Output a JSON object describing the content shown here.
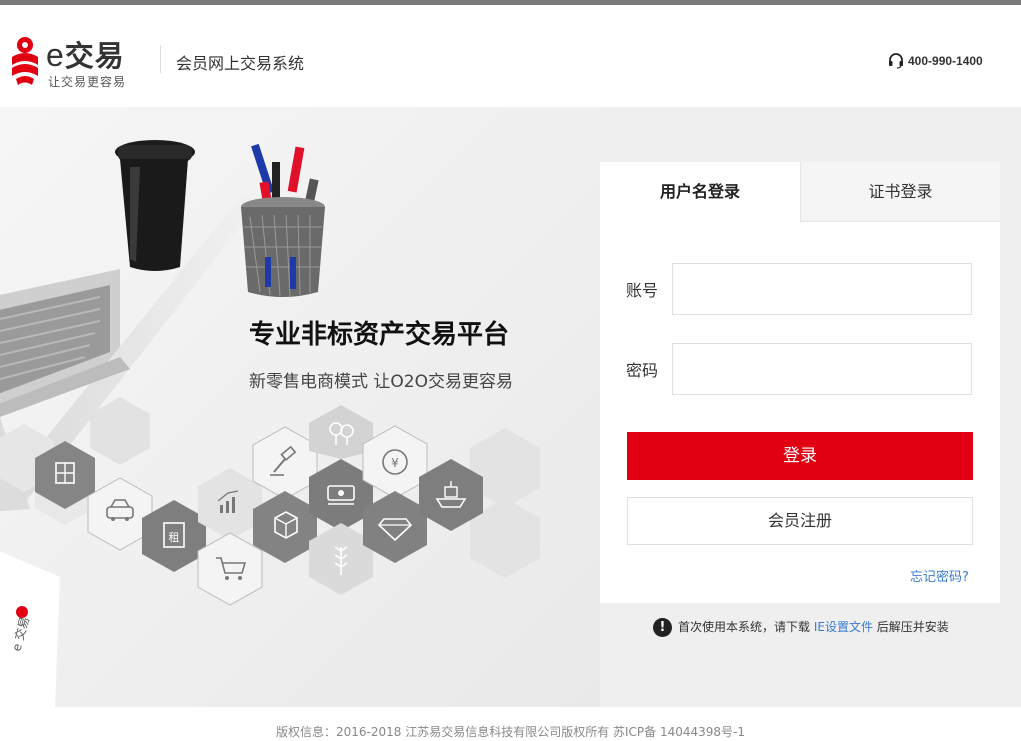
{
  "header": {
    "logo_letter": "e",
    "logo_name": "交易",
    "slogan": "让交易更容易",
    "system_title": "会员网上交易系统",
    "phone": "400-990-1400"
  },
  "hero": {
    "title": "专业非标资产交易平台",
    "subtitle": "新零售电商模式 让O2O交易更容易",
    "hex_icons": [
      "building-icon",
      "car-icon",
      "lease-icon",
      "chart-icon",
      "cart-icon",
      "gavel-icon",
      "box-icon",
      "money-icon",
      "tree-icon",
      "yuan-icon",
      "diamond-icon",
      "wheat-icon",
      "ship-icon"
    ],
    "hex_badge_text": "租"
  },
  "login": {
    "tabs": [
      "用户名登录",
      "证书登录"
    ],
    "account_label": "账号",
    "password_label": "密码",
    "account_value": "",
    "password_value": "",
    "login_button": "登录",
    "register_button": "会员注册",
    "forgot_link": "忘记密码?"
  },
  "notice": {
    "icon": "!",
    "prefix": "首次使用本系统，请下载 ",
    "link": "IE设置文件",
    "suffix": " 后解压并安装"
  },
  "footer": {
    "copyright": "版权信息：2016-2018 江苏易交易信息科技有限公司版权所有 苏ICP备 14044398号-1"
  },
  "colors": {
    "accent_red": "#e00012",
    "link_blue": "#3a7bd5",
    "hex_dark": "#8a8a8a",
    "hex_light": "#e4e4e4"
  }
}
